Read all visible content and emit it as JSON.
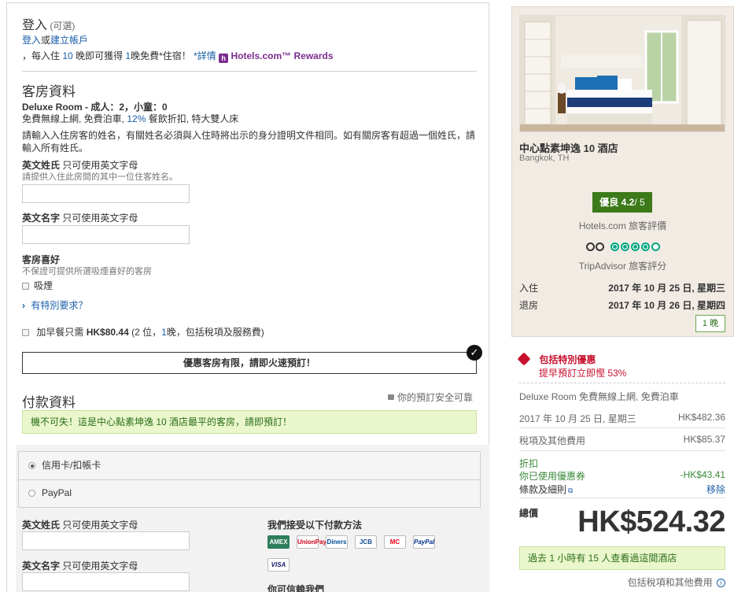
{
  "login": {
    "title": "登入",
    "optional": "(可選)",
    "login_link": "登入",
    "or": "或",
    "create_link": "建立帳戶",
    "rewards_text_prefix": "，每入住",
    "rewards_num": "10",
    "rewards_text_mid": "晚即可獲得",
    "rewards_num2": "1",
    "rewards_text_suffix": "晚免費*住宿！",
    "details_link": "*詳情",
    "rewards_brand": "Hotels.com™ Rewards"
  },
  "room": {
    "title": "客房資料",
    "room_name": "Deluxe Room - 成人：2，小童：0",
    "amenities_a": "免費無線上網, 免費泊車,",
    "amenities_pct": "12%",
    "amenities_b": "餐飲折扣, 特大雙人床",
    "notice": "請輸入入住房客的姓名，有關姓名必須與入住時將出示的身分證明文件相同。如有關房客有超過一個姓氏，請輸入所有姓氏。",
    "surname_label": "英文姓氏",
    "surname_hint": "只可使用英文字母",
    "surname_sub": "請提供入住此房間的其中一位住客姓名。",
    "given_label": "英文名字",
    "given_hint": "只可使用英文字母",
    "pref_title": "客房喜好",
    "pref_sub": "不保證可提供所選吸煙喜好的客房",
    "smoking": "吸煙",
    "special_request": "有特別要求？",
    "breakfast_a": "加早餐只需",
    "breakfast_price": "HK$80.44",
    "breakfast_b": "(2 位，",
    "breakfast_nights": "1",
    "breakfast_c": "晚，包括稅項及服務費)"
  },
  "urgency_banner": "優惠客房有限，請即火速預訂！",
  "payment": {
    "title": "付款資料",
    "secure": "你的預訂安全可靠",
    "promo": "機不可失！這是中心點素坤逸 10 酒店最平的客房，請即預訂！",
    "option_card": "信用卡/扣帳卡",
    "option_paypal": "PayPal",
    "surname_label": "英文姓氏",
    "surname_hint": "只可使用英文字母",
    "given_label": "英文名字",
    "given_hint": "只可使用英文字母",
    "accepted_title": "我們接受以下付款方法",
    "methods": [
      "AMEX",
      "UnionPay",
      "Diners",
      "JCB",
      "MC",
      "PayPal",
      "VISA"
    ],
    "trust_title": "你可信賴我們"
  },
  "hotel": {
    "name": "中心點素坤逸 10 酒店",
    "location": "Bangkok, TH",
    "rating_word": "優良",
    "rating_value": "4.2",
    "rating_max": "/ 5",
    "rating_source": "Hotels.com 旅客評價",
    "ta_circles": 4,
    "ta_source": "TripAdvisor 旅客評分",
    "checkin_label": "入住",
    "checkin_value": "2017 年 10 月 25 日, 星期三",
    "checkout_label": "退房",
    "checkout_value": "2017 年 10 月 26 日, 星期四",
    "nights": "1 晚"
  },
  "summary": {
    "special_title": "包括特別優惠",
    "special_sub": "提早預訂立即慳 53%",
    "room_line": "Deluxe Room 免費無線上網, 免費泊車",
    "date_line": "2017 年 10 月 25 日, 星期三",
    "date_price": "HK$482.36",
    "tax_label": "稅項及其他費用",
    "tax_price": "HK$85.37",
    "discount_title": "折扣",
    "coupon_label": "你已使用優惠券",
    "coupon_value": "-HK$43.41",
    "terms_link": "條款及細則",
    "remove_link": "移除",
    "total_label": "總價",
    "total_value": "HK$524.32",
    "viewers": "過去 1 小時有 15 人查看過這間酒店",
    "incl_tax": "包括稅項和其他費用"
  },
  "colors": {
    "link": "#1a5fa6",
    "rating_green": "#3c7a1a",
    "promo_bg": "#eaf7cc",
    "special_red": "#c8102e",
    "ta_green": "#00a680"
  }
}
